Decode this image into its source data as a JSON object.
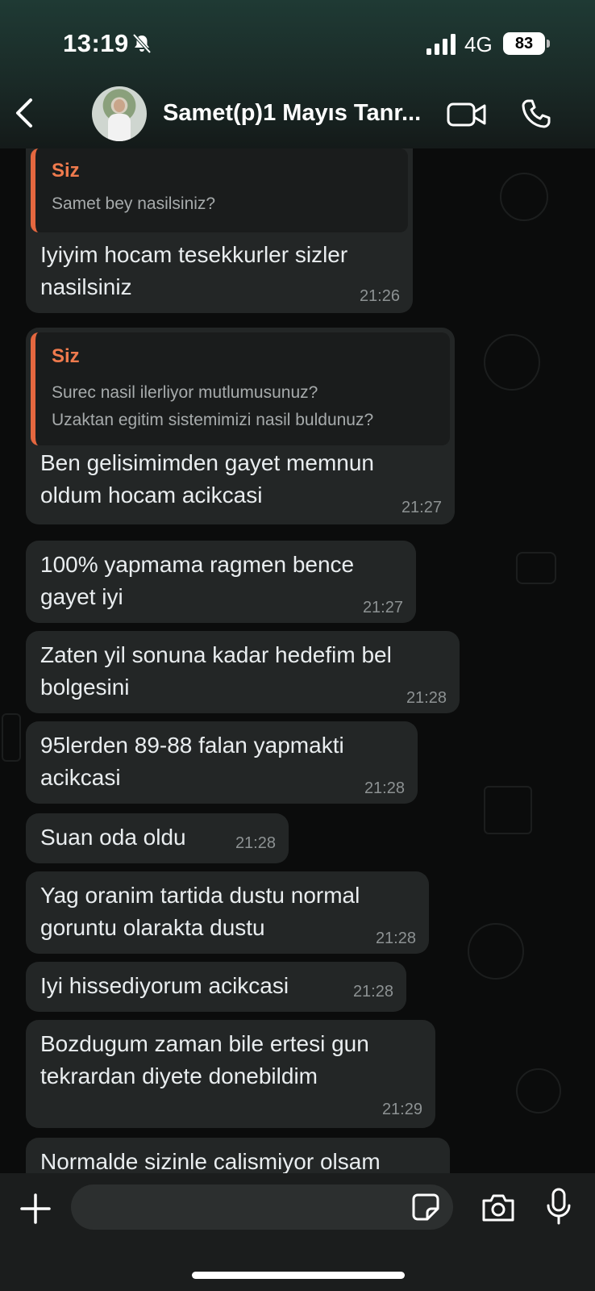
{
  "status_bar": {
    "time": "13:19",
    "network": "4G",
    "battery": "83"
  },
  "header": {
    "contact_name": "Samet(p)1 Mayıs Tanr..."
  },
  "messages": [
    {
      "quote_sender": "Siz",
      "quote_lines": [
        "Samet bey nasilsiniz?"
      ],
      "lines": [
        "Iyiyim hocam tesekkurler sizler",
        "nasilsiniz"
      ],
      "time": "21:26"
    },
    {
      "quote_sender": "Siz",
      "quote_lines": [
        "Surec nasil ilerliyor mutlumusunuz?",
        "Uzaktan egitim sistemimizi nasil buldunuz?"
      ],
      "lines": [
        "Ben gelisimimden gayet memnun",
        "oldum hocam acikcasi"
      ],
      "time": "21:27"
    },
    {
      "lines": [
        "100% yapmama ragmen bence",
        "gayet iyi"
      ],
      "time": "21:27"
    },
    {
      "lines": [
        "Zaten yil sonuna kadar hedefim bel",
        "bolgesini"
      ],
      "time": "21:28"
    },
    {
      "lines": [
        "95lerden 89-88 falan yapmakti",
        "acikcasi"
      ],
      "time": "21:28"
    },
    {
      "lines": [
        "Suan oda oldu"
      ],
      "time": "21:28"
    },
    {
      "lines": [
        "Yag oranim tartida dustu normal",
        "goruntu olarakta dustu"
      ],
      "time": "21:28"
    },
    {
      "lines": [
        "Iyi hissediyorum acikcasi"
      ],
      "time": "21:28"
    },
    {
      "lines": [
        "Bozdugum zaman bile ertesi gun",
        "tekrardan diyete donebildim"
      ],
      "time": "21:29"
    },
    {
      "lines": [
        "Normalde sizinle calismiyor olsam"
      ]
    }
  ],
  "icons": [
    "bell-slash-icon",
    "signal-icon",
    "back-chevron-icon",
    "video-call-icon",
    "phone-icon",
    "plus-icon",
    "sticker-icon",
    "camera-icon",
    "microphone-icon"
  ],
  "colors": {
    "bubble": "#232626",
    "quote_accent": "#e5673f",
    "quote_name": "#ef7a4d",
    "background": "#0b0c0c"
  }
}
